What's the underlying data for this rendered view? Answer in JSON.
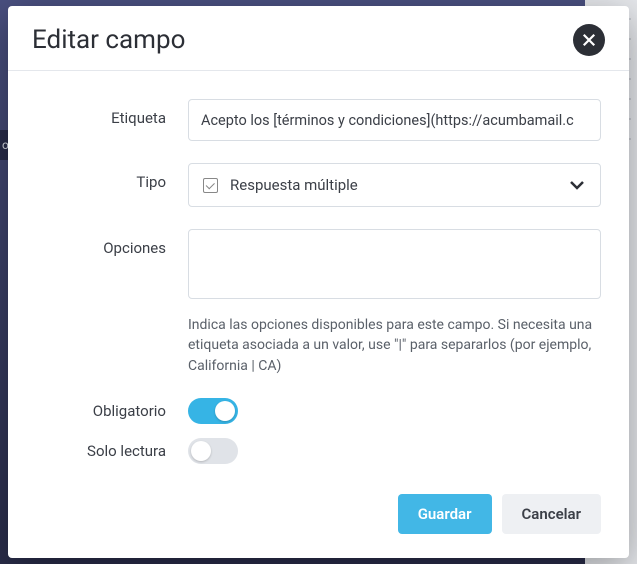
{
  "modal": {
    "title": "Editar campo"
  },
  "form": {
    "etiqueta": {
      "label": "Etiqueta",
      "value": "Acepto los [términos y condiciones](https://acumbamail.c"
    },
    "tipo": {
      "label": "Tipo",
      "selected": "Respuesta múltiple"
    },
    "opciones": {
      "label": "Opciones",
      "value": "",
      "help": "Indica las opciones disponibles para este campo. Si necesita una etiqueta asociada a un valor, use \"|\" para separarlos (por ejemplo, California | CA)"
    },
    "obligatorio": {
      "label": "Obligatorio",
      "on": true
    },
    "solo_lectura": {
      "label": "Solo lectura",
      "on": false
    }
  },
  "buttons": {
    "save": "Guardar",
    "cancel": "Cancelar"
  }
}
